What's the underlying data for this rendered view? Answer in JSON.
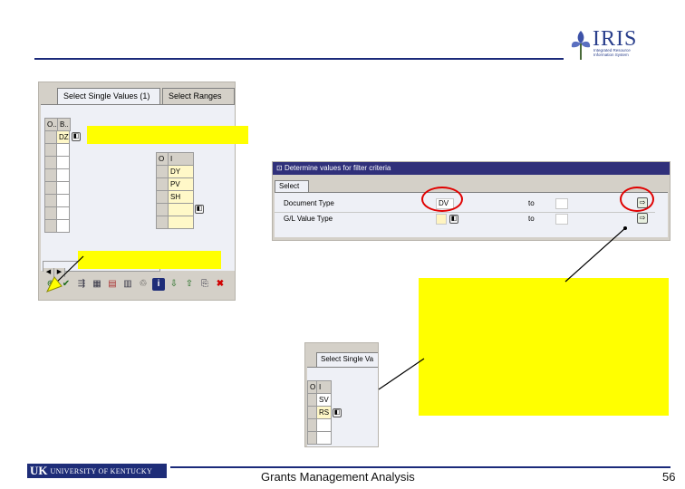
{
  "logo": {
    "brand": "IRIS",
    "subtitle": "Integrated Resource Information System"
  },
  "panel1": {
    "tabs": [
      "Select Single Values (1)",
      "Select Ranges"
    ],
    "grid_headers": [
      "O..",
      "B.."
    ],
    "grid_value": "DZ",
    "grid2_headers": [
      "O",
      "I"
    ],
    "grid2_values": [
      "DY",
      "PV",
      "SH"
    ]
  },
  "panel2": {
    "title": "Determine values for filter criteria",
    "tab": "Select",
    "fields": [
      {
        "label": "Document Type",
        "value": "DV",
        "to": "to"
      },
      {
        "label": "G/L Value Type",
        "value": "",
        "to": "to"
      }
    ]
  },
  "panel3": {
    "tab": "Select Single Va",
    "headers": [
      "O",
      "I"
    ],
    "values": [
      "SV",
      "RS"
    ]
  },
  "footer": {
    "university": "UNIVERSITY OF KENTUCKY",
    "uk_mark": "UK",
    "title": "Grants Management Analysis",
    "page": "56"
  },
  "icons": [
    "f4-help-icon",
    "execute-icon",
    "check-icon",
    "delete-icon",
    "info-icon",
    "cancel-icon"
  ],
  "colors": {
    "highlight": "#ffff00",
    "circle": "#e00000",
    "brand": "#1e2d78"
  }
}
